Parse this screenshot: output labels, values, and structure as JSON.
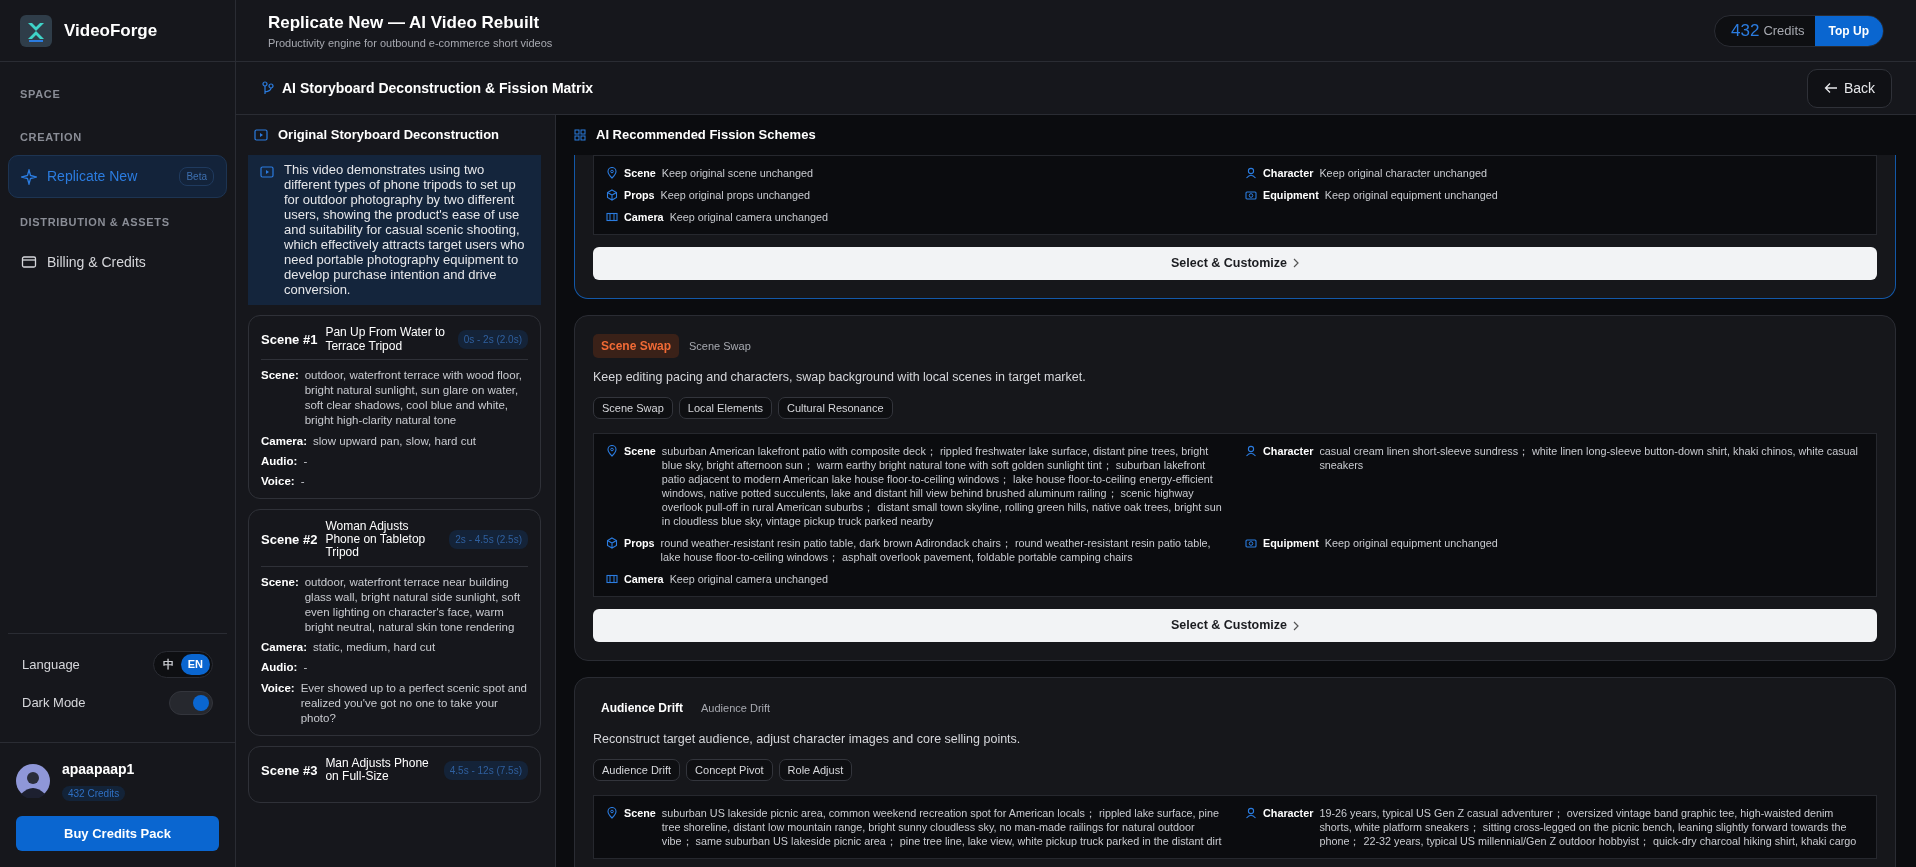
{
  "sidebar": {
    "brand": "VideoForge",
    "sections": [
      {
        "heading": "SPACE"
      },
      {
        "heading": "CREATION",
        "items": [
          {
            "label": "Replicate New",
            "badge": "Beta",
            "selected": true
          }
        ]
      },
      {
        "heading": "DISTRIBUTION & ASSETS",
        "items": [
          {
            "label": "Billing & Credits",
            "selected": false
          }
        ]
      }
    ],
    "settings": [
      {
        "kind": "segmented",
        "label": "Language",
        "options": [
          {
            "label": "中",
            "selected": false
          },
          {
            "label": "EN",
            "selected": true
          }
        ]
      },
      {
        "kind": "switch",
        "label": "Dark Mode",
        "on": true
      }
    ],
    "user": {
      "name": "apaapaap1",
      "credits": "432 Credits"
    },
    "buy_button": "Buy Credits Pack"
  },
  "header": {
    "title": "Replicate New — AI Video Rebuilt",
    "subtitle": "Productivity engine for outbound e-commerce short videos",
    "credits_value": "432",
    "credits_label": "Credits",
    "top_up": "Top Up"
  },
  "toolbar": {
    "title": "AI Storyboard Deconstruction & Fission Matrix",
    "back": "Back"
  },
  "storyboard": {
    "title": "Original Storyboard Deconstruction",
    "summary": "This video demonstrates using two different types of phone tripods to set up for outdoor photography by two different users, showing the product's ease of use and suitability for casual scenic shooting, which effectively attracts target users who need portable photography equipment to develop purchase intention and drive conversion.",
    "scenes": [
      {
        "number": "Scene #1",
        "title": "Pan Up From Water to Terrace Tripod",
        "time": "0s - 2s (2.0s)",
        "fields": [
          {
            "label": "Scene:",
            "value": "outdoor, waterfront terrace with wood floor, bright natural sunlight, sun glare on water, soft clear shadows, cool blue and white, bright high-clarity natural tone"
          },
          {
            "label": "Camera:",
            "value": "slow upward pan, slow, hard cut"
          },
          {
            "label": "Audio:",
            "value": "-"
          },
          {
            "label": "Voice:",
            "value": "-"
          }
        ]
      },
      {
        "number": "Scene #2",
        "title": "Woman Adjusts Phone on Tabletop Tripod",
        "time": "2s - 4.5s (2.5s)",
        "fields": [
          {
            "label": "Scene:",
            "value": "outdoor, waterfront terrace near building glass wall, bright natural side sunlight, soft even lighting on character's face, warm bright neutral, natural skin tone rendering"
          },
          {
            "label": "Camera:",
            "value": "static, medium, hard cut"
          },
          {
            "label": "Audio:",
            "value": "-"
          },
          {
            "label": "Voice:",
            "value": "Ever showed up to a perfect scenic spot and realized you've got no one to take your photo?"
          }
        ]
      },
      {
        "number": "Scene #3",
        "title": "Man Adjusts Phone on Full-Size",
        "time": "4.5s - 12s (7.5s)"
      }
    ]
  },
  "fission": {
    "title": "AI Recommended Fission Schemes",
    "schemes": [
      {
        "selected": true,
        "details": [
          {
            "kind": "scene",
            "label": "Scene",
            "value": "Keep original scene unchanged"
          },
          {
            "kind": "character",
            "label": "Character",
            "value": "Keep original character unchanged"
          },
          {
            "kind": "props",
            "label": "Props",
            "value": "Keep original props unchanged"
          },
          {
            "kind": "equipment",
            "label": "Equipment",
            "value": "Keep original equipment unchanged"
          },
          {
            "kind": "camera",
            "label": "Camera",
            "value": "Keep original camera unchanged"
          }
        ],
        "button": "Select & Customize"
      },
      {
        "selected": false,
        "tag": "Scene Swap",
        "highlighted": true,
        "subtitle": "Scene Swap",
        "description": "Keep editing pacing and characters, swap background with local scenes in target market.",
        "chips": [
          "Scene Swap",
          "Local Elements",
          "Cultural Resonance"
        ],
        "details": [
          {
            "kind": "scene",
            "label": "Scene",
            "value": "suburban American lakefront patio with composite deck； rippled freshwater lake surface, distant pine trees, bright blue sky, bright afternoon sun； warm earthy bright natural tone with soft golden sunlight tint； suburban lakefront patio adjacent to modern American lake house floor-to-ceiling windows； lake house floor-to-ceiling energy-efficient windows, native potted succulents, lake and distant hill view behind brushed aluminum railing； scenic highway overlook pull-off in rural American suburbs； distant small town skyline, rolling green hills, native oak trees, bright sun in cloudless blue sky, vintage pickup truck parked nearby"
          },
          {
            "kind": "character",
            "label": "Character",
            "value": "casual cream linen short-sleeve sundress； white linen long-sleeve button-down shirt, khaki chinos, white casual sneakers"
          },
          {
            "kind": "props",
            "label": "Props",
            "value": "round weather-resistant resin patio table, dark brown Adirondack chairs； round weather-resistant resin patio table, lake house floor-to-ceiling windows； asphalt overlook pavement, foldable portable camping chairs"
          },
          {
            "kind": "equipment",
            "label": "Equipment",
            "value": "Keep original equipment unchanged"
          },
          {
            "kind": "camera",
            "label": "Camera",
            "value": "Keep original camera unchanged"
          }
        ],
        "button": "Select & Customize"
      },
      {
        "selected": false,
        "tag": "Audience Drift",
        "highlighted": false,
        "subtitle": "Audience Drift",
        "description": "Reconstruct target audience, adjust character images and core selling points.",
        "chips": [
          "Audience Drift",
          "Concept Pivot",
          "Role Adjust"
        ],
        "details": [
          {
            "kind": "scene",
            "label": "Scene",
            "value": "suburban US lakeside picnic area, common weekend recreation spot for American locals； rippled lake surface, pine tree shoreline, distant low mountain range, bright sunny cloudless sky, no man-made railings for natural outdoor vibe； same suburban US lakeside picnic area； pine tree line, lake view, white pickup truck parked in the distant dirt"
          },
          {
            "kind": "character",
            "label": "Character",
            "value": "19-26 years, typical US Gen Z casual adventurer； oversized vintage band graphic tee, high-waisted denim shorts, white platform sneakers； sitting cross-legged on the picnic bench, leaning slightly forward towards the phone； 22-32 years, typical US millennial/Gen Z outdoor hobbyist； quick-dry charcoal hiking shirt, khaki cargo"
          }
        ]
      }
    ]
  }
}
